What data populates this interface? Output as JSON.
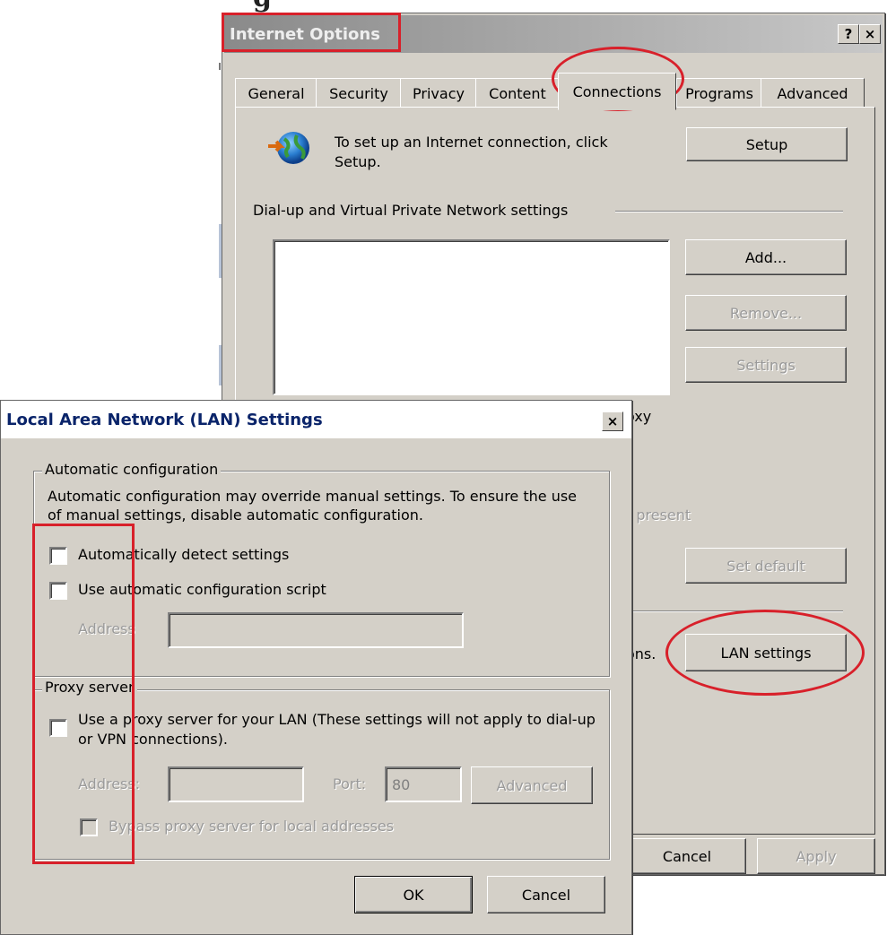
{
  "background": {
    "heading_fragment": "g"
  },
  "internet_options": {
    "title": "Internet Options",
    "help_label": "?",
    "close_label": "×",
    "tabs": [
      {
        "label": "General"
      },
      {
        "label": "Security"
      },
      {
        "label": "Privacy"
      },
      {
        "label": "Content"
      },
      {
        "label": "Connections",
        "selected": true
      },
      {
        "label": "Programs"
      },
      {
        "label": "Advanced"
      }
    ],
    "setup_text": "To set up an Internet connection, click Setup.",
    "setup_button": "Setup",
    "dialup_group": "Dial-up and Virtual Private Network settings",
    "add_button": "Add...",
    "remove_button": "Remove...",
    "settings_button": "Settings",
    "partial_proxy_text": "oxy",
    "partial_present_text": "t present",
    "set_default_button": "Set default",
    "partial_ons_text": "ons.",
    "lan_settings_button": "LAN settings",
    "cancel_button": "Cancel",
    "apply_button": "Apply"
  },
  "lan_dialog": {
    "title": "Local Area Network (LAN) Settings",
    "close_label": "×",
    "auto_config": {
      "legend": "Automatic configuration",
      "description": "Automatic configuration may override manual settings.  To ensure the use of manual settings, disable automatic configuration.",
      "auto_detect_label": "Automatically detect settings",
      "auto_script_label": "Use automatic configuration script",
      "address_label": "Address"
    },
    "proxy": {
      "legend": "Proxy server",
      "use_proxy_label": "Use a proxy server for your LAN (These settings will not apply to dial-up or VPN connections).",
      "address_label": "Address:",
      "port_label": "Port:",
      "port_value": "80",
      "advanced_button": "Advanced",
      "bypass_label": "Bypass proxy server for local addresses"
    },
    "ok_button": "OK",
    "cancel_button": "Cancel"
  },
  "colors": {
    "dialog_face": "#d4d0c8",
    "highlight_red": "#d8202a",
    "active_title_text": "#0a246a"
  },
  "icons": [
    "globe-network-icon",
    "help-icon",
    "close-icon"
  ]
}
